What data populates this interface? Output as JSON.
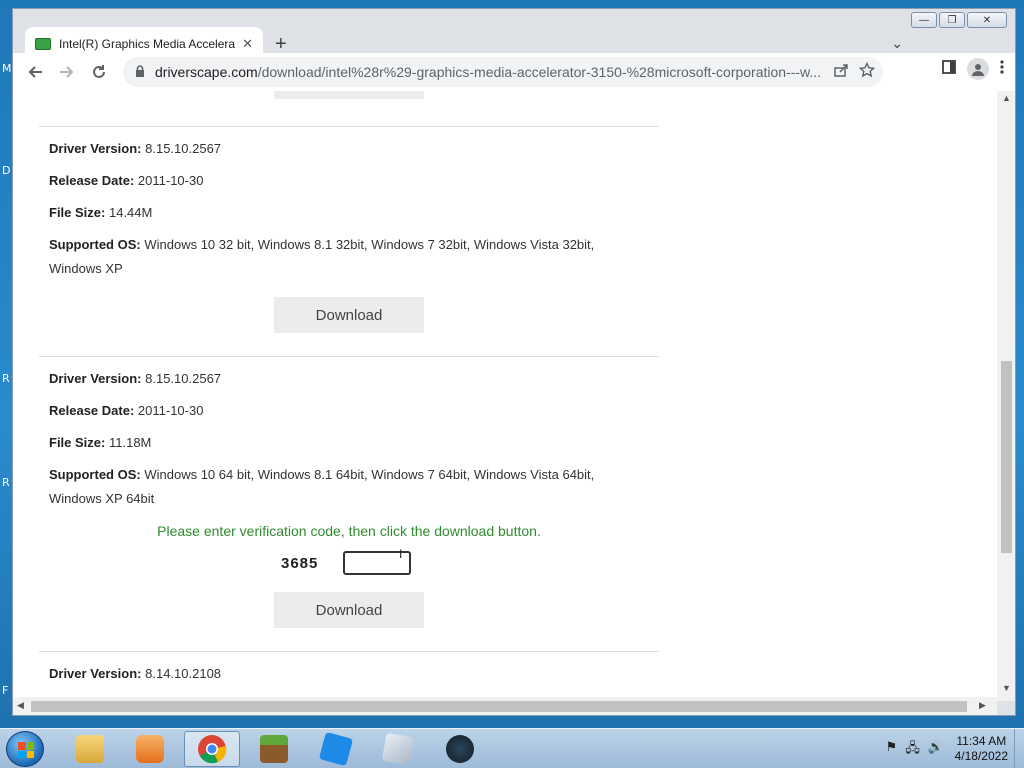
{
  "browser": {
    "tab_title": "Intel(R) Graphics Media Accelerator",
    "tab_close": "✕",
    "new_tab": "+",
    "tab_menu": "⌄",
    "url_host": "driverscape.com",
    "url_path": "/download/intel%28r%29-graphics-media-accelerator-3150-%28microsoft-corporation---w...",
    "window_controls": {
      "minimize": "—",
      "restore": "❐",
      "close": "✕"
    }
  },
  "entries": [
    {
      "driver_version_label": "Driver Version:",
      "driver_version": "8.15.10.2567",
      "release_date_label": "Release Date:",
      "release_date": "2011-10-30",
      "file_size_label": "File Size:",
      "file_size": "14.44M",
      "supported_os_label": "Supported OS:",
      "supported_os_line1": "Windows 10 32 bit, Windows 8.1 32bit, Windows 7 32bit, Windows Vista 32bit,",
      "supported_os_line2": "Windows XP",
      "download_label": "Download"
    },
    {
      "driver_version_label": "Driver Version:",
      "driver_version": "8.15.10.2567",
      "release_date_label": "Release Date:",
      "release_date": "2011-10-30",
      "file_size_label": "File Size:",
      "file_size": "11.18M",
      "supported_os_label": "Supported OS:",
      "supported_os_line1": "Windows 10 64 bit, Windows 8.1 64bit, Windows 7 64bit, Windows Vista 64bit,",
      "supported_os_line2": "Windows XP 64bit",
      "verification_prompt": "Please enter verification code, then click the download button.",
      "captcha_code": "3685",
      "captcha_value": "",
      "download_label": "Download"
    },
    {
      "driver_version_label": "Driver Version:",
      "driver_version": "8.14.10.2108"
    }
  ],
  "desktop_letters": [
    "M",
    "D",
    "R",
    "R",
    "F"
  ],
  "taskbar": {
    "clock_time": "11:34 AM",
    "clock_date": "4/18/2022",
    "apps": [
      "file-explorer",
      "media-player",
      "chrome",
      "minecraft",
      "roblox",
      "unknown-app",
      "steam"
    ]
  }
}
